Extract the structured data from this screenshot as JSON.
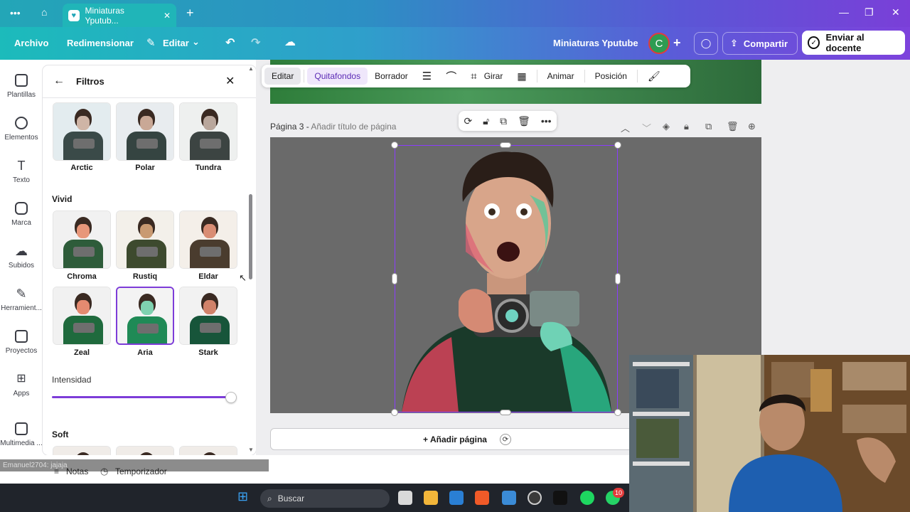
{
  "browser": {
    "tab_title": "Miniaturas Yputub...",
    "menu_icon": "more-dots-icon",
    "home_icon": "home-icon",
    "new_tab_icon": "plus-icon",
    "close_icon": "close-icon"
  },
  "topbar": {
    "menu": [
      "Archivo",
      "Redimensionar"
    ],
    "edit_label": "Editar",
    "project_title": "Miniaturas Yputube",
    "avatar_letter": "C",
    "share_label": "Compartir",
    "send_label": "Enviar al docente"
  },
  "sidebar": {
    "items": [
      {
        "label": "Plantillas",
        "icon": "templates-icon"
      },
      {
        "label": "Elementos",
        "icon": "elements-icon"
      },
      {
        "label": "Texto",
        "icon": "text-icon"
      },
      {
        "label": "Marca",
        "icon": "brand-icon"
      },
      {
        "label": "Subidos",
        "icon": "upload-icon"
      },
      {
        "label": "Herramient...",
        "icon": "tools-icon"
      },
      {
        "label": "Proyectos",
        "icon": "folder-icon"
      },
      {
        "label": "Apps",
        "icon": "apps-icon"
      },
      {
        "label": "Multimedia ...",
        "icon": "media-icon"
      }
    ]
  },
  "panel": {
    "title": "Filtros",
    "row1": [
      "Arctic",
      "Polar",
      "Tundra"
    ],
    "section_vivid": "Vivid",
    "row2": [
      "Chroma",
      "Rustiq",
      "Eldar"
    ],
    "row3": [
      "Zeal",
      "Aria",
      "Stark"
    ],
    "selected_filter": "Aria",
    "intensity_label": "Intensidad",
    "intensity_value": 1.0,
    "section_soft": "Soft"
  },
  "edit_toolbar": {
    "items": [
      "Editar",
      "Quitafondos",
      "Borrador",
      "Girar",
      "Animar",
      "Posición"
    ]
  },
  "page": {
    "label": "Página 3 -",
    "title_placeholder": "Añadir título de página",
    "add_page_label": "+ Añadir página"
  },
  "bottom": {
    "notes_label": "Notas",
    "timer_label": "Temporizador",
    "watermark": "Emanuel2704: jajaja"
  },
  "taskbar": {
    "search_placeholder": "Buscar",
    "whatsapp_badge": "10"
  },
  "colors": {
    "accent": "#7d3cd8",
    "topbar_start": "#1cbbbb",
    "topbar_end": "#7d42dc"
  }
}
